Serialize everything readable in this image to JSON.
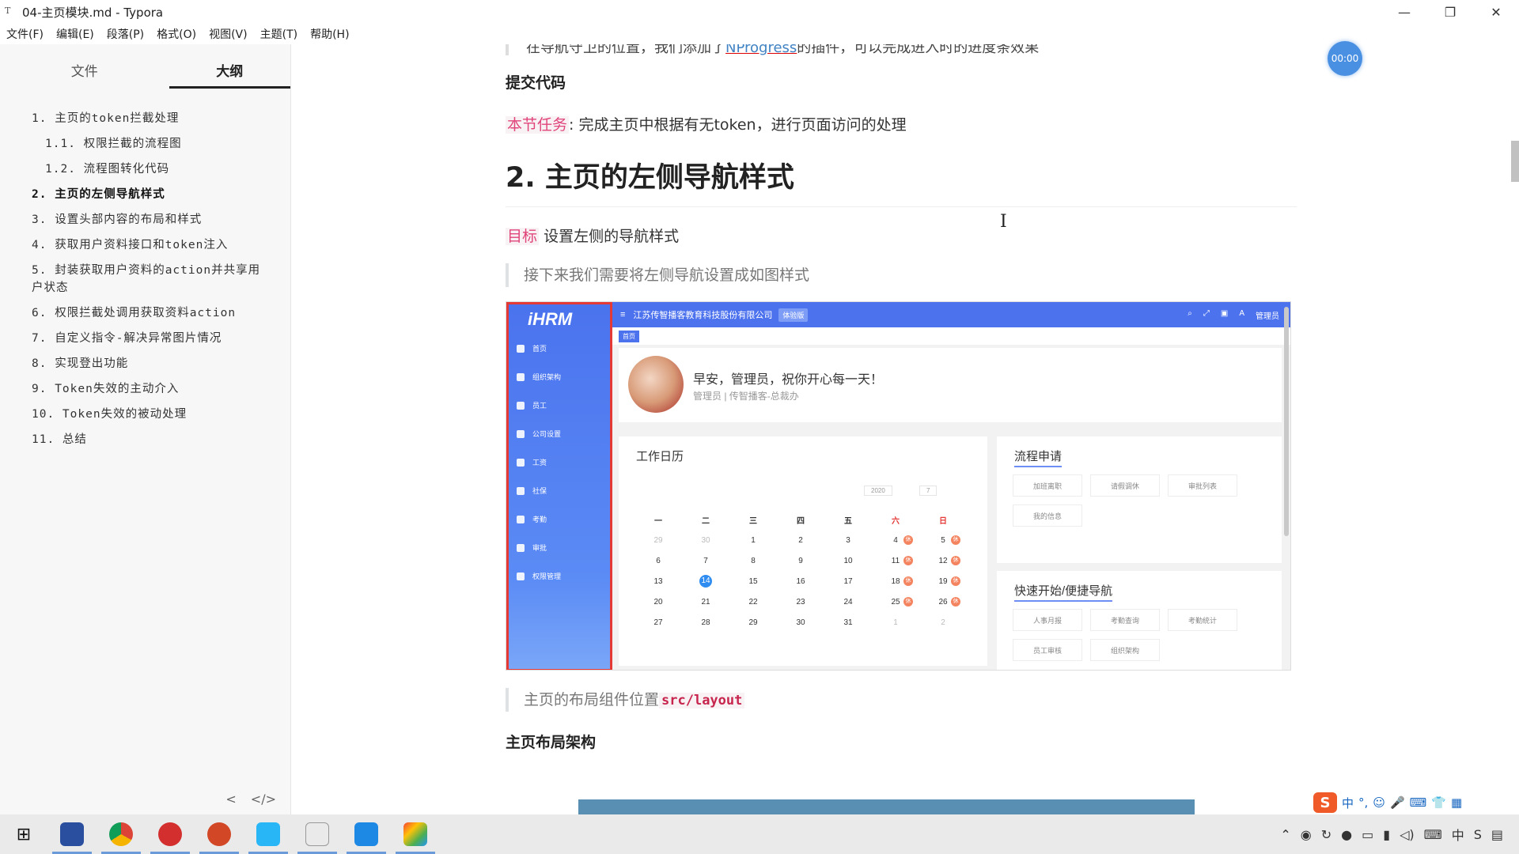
{
  "window": {
    "title": "04-主页模块.md - Typora",
    "controls": [
      "—",
      "❐",
      "✕"
    ]
  },
  "menu": [
    "文件(F)",
    "编辑(E)",
    "段落(P)",
    "格式(O)",
    "视图(V)",
    "主题(T)",
    "帮助(H)"
  ],
  "sidebar": {
    "tabs": [
      "文件",
      "大纲"
    ],
    "outline": [
      "1. 主页的token拦截处理",
      "1.1. 权限拦截的流程图",
      "1.2. 流程图转化代码",
      "2. 主页的左侧导航样式",
      "3. 设置头部内容的布局和样式",
      "4. 获取用户资料接口和token注入",
      "5. 封装获取用户资料的action并共享用户状态",
      "6. 权限拦截处调用获取资料action",
      "7. 自定义指令-解决异常图片情况",
      "8. 实现登出功能",
      "9. Token失效的主动介入",
      "10. Token失效的被动处理",
      "11. 总结"
    ],
    "footer": [
      "<",
      "</>"
    ]
  },
  "doc": {
    "cut_text_pre": "在导航守卫的位置，我们添加了",
    "cut_text_link": "NProgress",
    "cut_text_post": "的插件，可以完成进入时的进度条效果",
    "h_submit": "提交代码",
    "task_tag": "本节任务",
    "task_text": ": 完成主页中根据有无token，进行页面访问的处理",
    "h2": "2. 主页的左侧导航样式",
    "goal_tag": "目标",
    "goal_text": "设置左侧的导航样式",
    "quote1": "接下来我们需要将左侧导航设置成如图样式",
    "quote2_text": "主页的布局组件位置",
    "quote2_code": "src/layout",
    "h_layout": "主页布局架构"
  },
  "shot": {
    "logo": "iHRM",
    "nav": [
      "首页",
      "组织架构",
      "员工",
      "公司设置",
      "工资",
      "社保",
      "考勤",
      "审批",
      "权限管理"
    ],
    "company": "江苏传智播客教育科技股份有限公司",
    "version": "体验版",
    "user": "管理员",
    "crumb": "首页",
    "welcome": "早安，管理员，祝你开心每一天！",
    "welcome_sub": "管理员 | 传智播客-总裁办",
    "cal_title": "工作日历",
    "cal_year": "2020",
    "cal_month": "7",
    "cal_head": [
      "一",
      "二",
      "三",
      "四",
      "五",
      "六",
      "日"
    ],
    "cal_rows": [
      [
        "29",
        "30",
        "1",
        "2",
        "3",
        "4",
        "5"
      ],
      [
        "6",
        "7",
        "8",
        "9",
        "10",
        "11",
        "12"
      ],
      [
        "13",
        "14",
        "15",
        "16",
        "17",
        "18",
        "19"
      ],
      [
        "20",
        "21",
        "22",
        "23",
        "24",
        "25",
        "26"
      ],
      [
        "27",
        "28",
        "29",
        "30",
        "31",
        "1",
        "2"
      ]
    ],
    "flow_title": "流程申请",
    "flow_items": [
      "加班离职",
      "请假调休",
      "审批列表",
      "我的信息"
    ],
    "quick_title": "快速开始/便捷导航",
    "quick_items": [
      "人事月报",
      "考勤查询",
      "考勤统计",
      "员工审核",
      "组织架构"
    ]
  },
  "overlay": {
    "timer": "00:00"
  },
  "ime": [
    "中",
    "°,",
    "☺",
    "🎤",
    "⌨",
    "👕",
    "▦"
  ],
  "colors": {
    "accent": "#4c72ee",
    "tag": "#e0457b",
    "highlight_border": "#e53935"
  }
}
